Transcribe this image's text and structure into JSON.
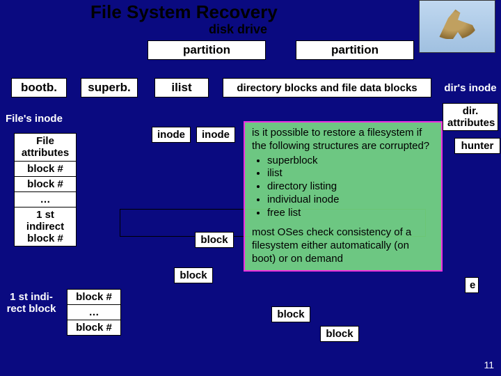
{
  "title": "File System Recovery",
  "subtitle": "disk drive",
  "partition1": "partition",
  "partition2": "partition",
  "row2": {
    "bootb": "bootb.",
    "superb": "superb.",
    "ilist": "ilist",
    "dirdata": "directory blocks and file data blocks"
  },
  "right_labels": {
    "dir_inode": "dir's inode",
    "dir_attr": "dir.\nattributes",
    "hunter": "hunter",
    "e_char": "e"
  },
  "file_inode_label": "File's inode",
  "file_col": {
    "attr": "File\nattributes",
    "b1": "block #",
    "b2": "block #",
    "dots": "…",
    "ind": "1 st\nindirect\nblock #"
  },
  "first_ind_label": "1 st indi-\nrect block",
  "ind_col": {
    "b1": "block #",
    "dots": "…",
    "b2": "block #"
  },
  "inode_cells": {
    "c1": "inode",
    "c2": "inode"
  },
  "blocks": {
    "b1": "block",
    "b2": "block",
    "b3": "block",
    "b4": "block"
  },
  "callout": {
    "question": "is it possible to restore a filesystem if the following structures are corrupted?",
    "items": [
      "superblock",
      "ilist",
      "directory listing",
      "individual inode",
      "free list"
    ],
    "answer": "most OSes check consistency of a filesystem either automatically (on boot) or on demand"
  },
  "slide_number": "11"
}
